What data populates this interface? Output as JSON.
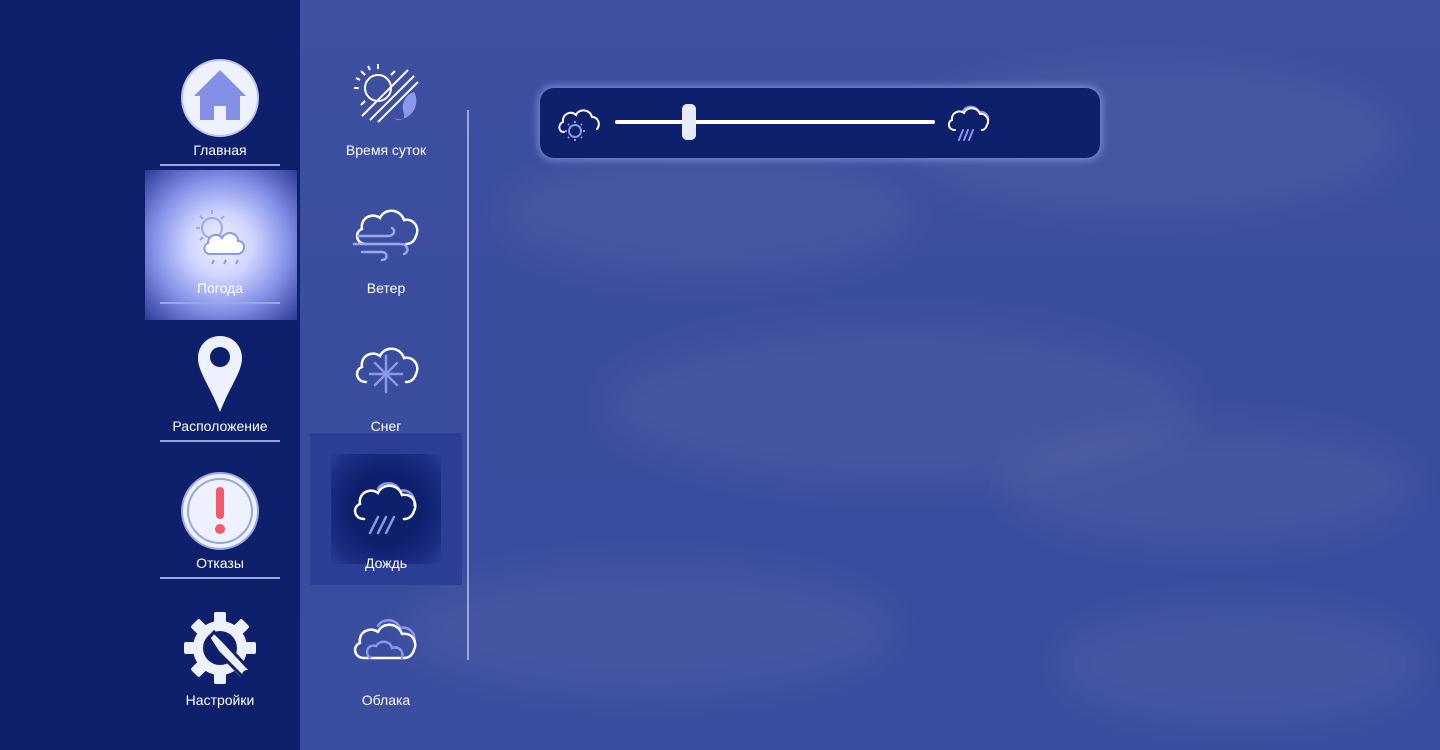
{
  "sidebar": {
    "items": [
      {
        "label": "Главная",
        "icon": "home-icon"
      },
      {
        "label": "Погода",
        "icon": "weather-icon",
        "selected": true
      },
      {
        "label": "Расположение",
        "icon": "location-pin-icon"
      },
      {
        "label": "Отказы",
        "icon": "warning-icon"
      },
      {
        "label": "Настройки",
        "icon": "settings-icon"
      }
    ]
  },
  "weather_menu": {
    "items": [
      {
        "label": "Время суток",
        "icon": "day-night-icon"
      },
      {
        "label": "Ветер",
        "icon": "wind-cloud-icon"
      },
      {
        "label": "Снег",
        "icon": "snow-cloud-icon"
      },
      {
        "label": "Дождь",
        "icon": "rain-cloud-icon",
        "selected": true
      },
      {
        "label": "Облака",
        "icon": "clouds-icon"
      }
    ]
  },
  "rain_slider": {
    "min_icon": "partly-cloudy-sun-icon",
    "max_icon": "heavy-rain-icon",
    "value_fraction": 0.23
  },
  "colors": {
    "sidebar_bg": "#0e1f6b",
    "content_bg": "#3d4f9f",
    "accent": "#8793e8",
    "text": "#ffffff",
    "alert": "#f05a6a"
  }
}
